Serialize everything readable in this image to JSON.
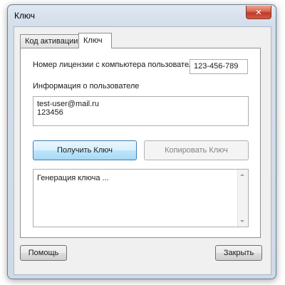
{
  "window": {
    "title": "Ключ",
    "close_glyph": "✕"
  },
  "tabs": [
    {
      "label": "Код активации",
      "active": false
    },
    {
      "label": "Ключ",
      "active": true
    }
  ],
  "license": {
    "label": "Номер лицензии с компьютера пользователя",
    "value": "123-456-789"
  },
  "user_info": {
    "label": "Информация о пользователе",
    "lines": [
      "test-user@mail.ru",
      "123456"
    ]
  },
  "buttons": {
    "get_key": "Получить Ключ",
    "copy_key": "Копировать Ключ",
    "help": "Помощь",
    "close": "Закрыть"
  },
  "output": {
    "text": "Генерация ключа ..."
  }
}
